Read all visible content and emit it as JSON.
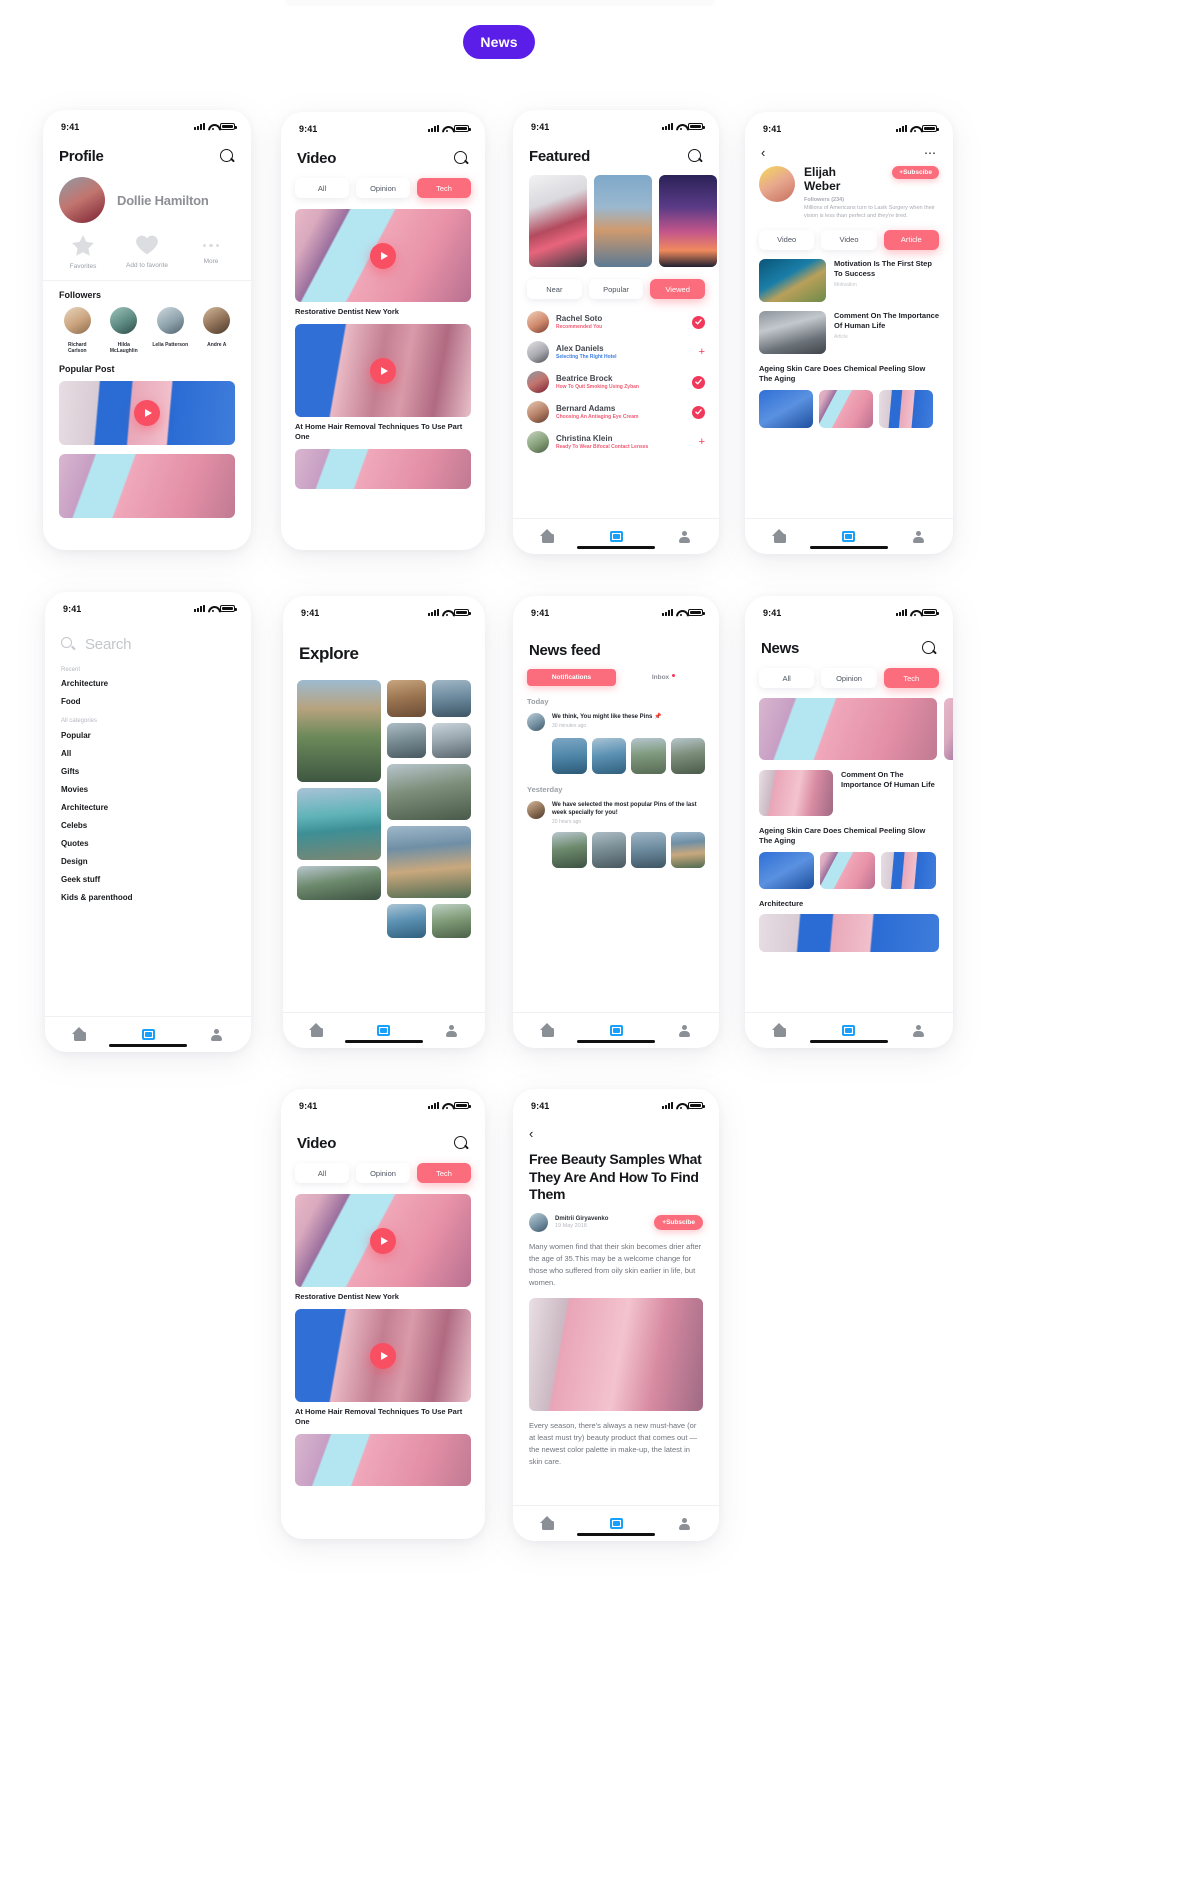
{
  "page": {
    "pill_label": "News",
    "accent": "#5B1EE8",
    "brand_pink": "#FB6D7C",
    "brand_blue": "#18A0FB"
  },
  "status_bar": {
    "time": "9:41",
    "signal_icon": "signal-bars-icon",
    "wifi_icon": "wifi-icon",
    "battery_icon": "battery-icon"
  },
  "tabbar": {
    "home_icon": "home-icon",
    "grid_icon": "grid-icon",
    "profile_icon": "user-icon"
  },
  "screens": [
    {
      "id": "profile",
      "title": "Profile",
      "search_icon": "search-icon",
      "user": {
        "name": "Dollie Hamilton",
        "avatar": "avatar-dollie"
      },
      "actions": [
        {
          "label": "Favorites",
          "icon": "star-icon"
        },
        {
          "label": "Add to favorite",
          "icon": "heart-icon"
        },
        {
          "label": "More",
          "icon": "ellipsis-icon"
        }
      ],
      "followers_heading": "Followers",
      "followers": [
        {
          "name": "Richard Carlson"
        },
        {
          "name": "Hilda McLaughlin"
        },
        {
          "name": "Lelia Patterson"
        },
        {
          "name": "Andre A"
        }
      ],
      "popular_heading": "Popular Post"
    },
    {
      "id": "video",
      "title": "Video",
      "search_icon": "search-icon",
      "chips": [
        {
          "label": "All",
          "active": false
        },
        {
          "label": "Opinion",
          "active": false
        },
        {
          "label": "Tech",
          "active": true
        }
      ],
      "items": [
        {
          "caption": "Restorative Dentist New York"
        },
        {
          "caption": "At Home Hair Removal Techniques To Use Part One"
        }
      ]
    },
    {
      "id": "featured",
      "title": "Featured",
      "search_icon": "search-icon",
      "chips": [
        {
          "label": "Near",
          "active": false
        },
        {
          "label": "Popular",
          "active": false
        },
        {
          "label": "Viewed",
          "active": true
        }
      ],
      "contacts": [
        {
          "name": "Rachel Soto",
          "subtitle": "Recommended You",
          "subtitle_color": "#F25C74",
          "state": "checked"
        },
        {
          "name": "Alex Daniels",
          "subtitle": "Selecting The Right Hotel",
          "subtitle_color": "#3C7DE0",
          "state": "add"
        },
        {
          "name": "Beatrice Brock",
          "subtitle": "How To Quit Smoking Using Zyban",
          "subtitle_color": "#F25C74",
          "state": "checked"
        },
        {
          "name": "Bernard Adams",
          "subtitle": "Choosing An Antiaging Eye Cream",
          "subtitle_color": "#F25C74",
          "state": "checked"
        },
        {
          "name": "Christina Klein",
          "subtitle": "Ready To Wear Bifocal Contact Lenses",
          "subtitle_color": "#F25C74",
          "state": "add"
        }
      ]
    },
    {
      "id": "author",
      "back_icon": "chevron-left-icon",
      "more_icon": "ellipsis-icon",
      "name": "Elijah Weber",
      "followers": "Followers (234)",
      "bio": "Millions of Americans turn to Lasik Surgery when their vision is less than perfect and they're tired.",
      "subscribe_label": "+Subscibe",
      "chips": [
        {
          "label": "Video",
          "active": false
        },
        {
          "label": "Video",
          "active": false
        },
        {
          "label": "Article",
          "active": true
        }
      ],
      "articles": [
        {
          "title": "Motivation Is The First Step To Success",
          "tag": "Motivation",
          "thumb": "turtle-thumb"
        },
        {
          "title": "Comment On The Importance Of Human Life",
          "tag": "Article",
          "thumb": "city-thumb"
        }
      ],
      "section_title": "Ageing Skin Care Does Chemical Peeling Slow The Aging"
    },
    {
      "id": "search",
      "search_placeholder": "Search",
      "search_icon": "search-icon",
      "groups": [
        {
          "label": "Recent",
          "items": [
            "Architecture",
            "Food"
          ]
        },
        {
          "label": "All categories",
          "items": [
            "Popular",
            "All",
            "Gifts",
            "Movies",
            "Architecture",
            "Celebs",
            "Quotes",
            "Design",
            "Geek stuff",
            "Kids & parenthood"
          ]
        }
      ]
    },
    {
      "id": "explore",
      "title": "Explore"
    },
    {
      "id": "newsfeed",
      "title": "News feed",
      "tabs": [
        {
          "label": "Notifications",
          "active": true,
          "dot": false
        },
        {
          "label": "Inbox",
          "active": false,
          "dot": true
        }
      ],
      "sections": [
        {
          "label": "Today",
          "text": "We think, You might like these Pins 📌",
          "time": "30 minutes ago"
        },
        {
          "label": "Yesterday",
          "text": "We have selected the most popular Pins of the last week specially for you!",
          "time": "20 hours ago"
        }
      ]
    },
    {
      "id": "news",
      "title": "News",
      "search_icon": "search-icon",
      "chips": [
        {
          "label": "All",
          "active": false
        },
        {
          "label": "Opinion",
          "active": false
        },
        {
          "label": "Tech",
          "active": true
        }
      ],
      "article_title": "Comment On The Importance Of Human Life",
      "section_title": "Ageing Skin Care Does Chemical Peeling Slow The Aging",
      "section_title2": "Architecture"
    },
    {
      "id": "video2",
      "title": "Video",
      "search_icon": "search-icon",
      "chips": [
        {
          "label": "All",
          "active": false
        },
        {
          "label": "Opinion",
          "active": false
        },
        {
          "label": "Tech",
          "active": true
        }
      ],
      "items": [
        {
          "caption": "Restorative Dentist New York"
        },
        {
          "caption": "At Home Hair Removal Techniques To Use Part One"
        }
      ]
    },
    {
      "id": "article",
      "back_icon": "chevron-left-icon",
      "headline": "Free Beauty Samples What They Are And How To Find Them",
      "author": "Dmitrii Giryavenko",
      "date": "19 May 2018",
      "subscribe_label": "+Subscibe",
      "paragraph1": "Many women find that their skin becomes drier after the age of 35.This may be a welcome change for those who suffered from oily skin earlier in life, but women.",
      "paragraph2": "Every season, there's always a new must-have (or at least must try) beauty product that comes out — the newest color palette in make-up, the latest in skin care."
    }
  ]
}
